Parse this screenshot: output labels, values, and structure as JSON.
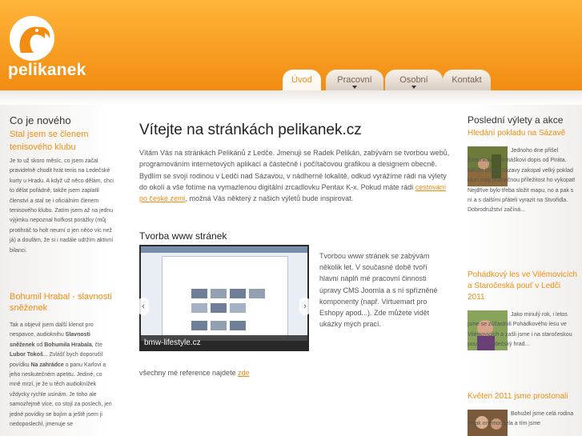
{
  "header": {
    "logo_text": "pelikanek",
    "nav": [
      {
        "label": "Úvod",
        "active": true,
        "has_dropdown": false
      },
      {
        "label": "Pracovní",
        "active": false,
        "has_dropdown": true
      },
      {
        "label": "Osobní",
        "active": false,
        "has_dropdown": true
      },
      {
        "label": "Kontakt",
        "active": false,
        "has_dropdown": false
      }
    ]
  },
  "left": {
    "title": "Co je nového",
    "item1_title": "Stal jsem se členem tenisového klubu",
    "item1_text": "Je to už skoro měsíc, co jsem začal pravidelně chodit hrát tenis na Ledečské kurty u Hradu. A když už něco dělám, chci to dělat pořádně, takže jsem zaplatil členství a stal se i oficiálním členem tenisového klubu. Zatím jsem až na jednu výjimku nepoznal hořkost porážky (můj protihráč to holt neumí o jen něco víc než já) a doufám, že si i nadále udržím aktivní bilanci.",
    "item2_title": "Bohumil Hrabal - slavnosti sněženek",
    "item2_text_a": "Tak a objevil jsem další klenot pro nespavce, audioknihu ",
    "item2_bold1": "Slavnosti sněženek",
    "item2_text_b": " od ",
    "item2_bold2": "Bohumila Hrabala",
    "item2_text_c": ", čte ",
    "item2_bold3": "Lubor Tokoš",
    "item2_text_d": "... Zvlášť bych doporučil povídku ",
    "item2_bold4": "Na zahrádce",
    "item2_text_e": " o panu Karlovi a jeho neskutečném apetitu. Jediné, co mně mrzí, je že u těch audioknížek vždycky rychle usínám. Je toho ale samozřejmě více, co stojí za poslech, jen jedné povídky se bojím a ještě jsem ji nedoposlechl, jmenuje se"
  },
  "main": {
    "title": "Vítejte na stránkách pelikanek.cz",
    "intro_a": "Vítám Vás na stránkách Pelikánů z Ledče. Jmenuji se Radek Pelikán, zabývám se tvorbou webů, programováním internetových aplikací a částečně i počítačovou grafikou a designem obecně. Bydlím se svojí rodinou v Ledči nad Sázavou, v nádherné lokalitě, odkud vyrážíme rádi na výlety do okolí a vše fotíme na vymazlenou digitální zrcadlovku Pentax K-x. Pokud máte rádi ",
    "intro_link": "cestování po české zemi",
    "intro_b": ", možná Vás některý z našich výletů bude inspirovat.",
    "section_title": "Tvorba www stránek",
    "slide_caption": "bmw-lifestyle.cz",
    "slider_prev": "‹",
    "slider_next": "›",
    "tvorba_text": "Tvorbou www stránek se zabývám několik let. V současné době tvoří hlavní náplň mé pracovní činnosti úpravy CMS Joomla a s ní spřízněné komponenty (např. Virtuemart pro Eshopy apod...). Zde můžete vidět ukázky mých prací.",
    "refs_text": "všechny mé reference najdete ",
    "refs_link": "zde"
  },
  "right": {
    "title": "Poslední výlety a akce",
    "trip1_title": "Hledání pokladu na Sázavě",
    "trip1_text": "Jednoho dne přišel Šimonkovi a Tomáškovi dopis od Piráta. Někde blízko Sázavy zakopal velký poklad kluci mají jedinečnou příležitost ho vykopat! Nejdříve bylo třeba složit mapu, no a pak s ní a s dalšími přáteli vyrazit na Stvořidla. Dobrodružství začíná...",
    "trip2_title": "Pohádkový les ve Vilémovicích a Staročeská pouť v Ledči 2011",
    "trip2_text": "Jako minulý rok, i letos jsme se zúčastnili Pohádkového lesu ve Vilémovicích a zašli jsme i na staročeskou pouť na Ledečský hrad...",
    "trip3_title": "Květen 2011 jsme prostonali",
    "trip3_text": "Bohužel jsme celá rodina nějak onemocněla a tím jsme"
  },
  "colors": {
    "accent": "#f28c12",
    "header_top": "#ffb43a",
    "header_bottom": "#f28c12",
    "text": "#555555"
  }
}
